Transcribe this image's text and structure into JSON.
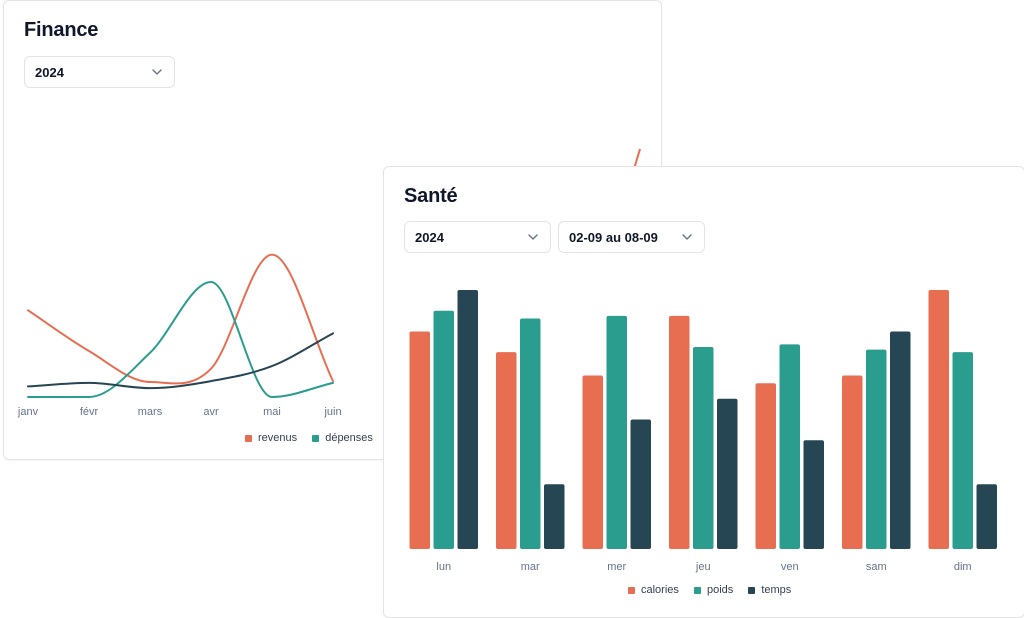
{
  "finance": {
    "title": "Finance",
    "year_select": {
      "value": "2024",
      "icon": "chevron-down-icon"
    },
    "legend": [
      {
        "label": "revenus",
        "color": "#e76e50"
      },
      {
        "label": "dépenses",
        "color": "#2a9d8f"
      }
    ]
  },
  "sante": {
    "title": "Santé",
    "year_select": {
      "value": "2024",
      "icon": "chevron-down-icon"
    },
    "range_select": {
      "value": "02-09 au 08-09",
      "icon": "chevron-down-icon"
    },
    "legend": [
      {
        "label": "calories",
        "color": "#e76e50"
      },
      {
        "label": "poids",
        "color": "#2a9d8f"
      },
      {
        "label": "temps",
        "color": "#264653"
      }
    ]
  },
  "chart_data": [
    {
      "type": "line",
      "categories": [
        "janv",
        "févr",
        "mars",
        "avr",
        "mai",
        "juin"
      ],
      "series": [
        {
          "name": "revenus",
          "color": "#e76e50",
          "values": [
            98,
            52,
            17,
            32,
            161,
            18
          ]
        },
        {
          "name": "dépenses",
          "color": "#2a9d8f",
          "values": [
            0,
            0,
            50,
            130,
            0,
            16
          ]
        },
        {
          "color": "#264653",
          "values": [
            12,
            16,
            10,
            18,
            35,
            72
          ]
        }
      ],
      "ylim": [
        0,
        190
      ],
      "grid": false,
      "legend_position": "bottom-right"
    },
    {
      "type": "bar",
      "categories": [
        "lun",
        "mar",
        "mer",
        "jeu",
        "ven",
        "sam",
        "dim"
      ],
      "series": [
        {
          "name": "calories",
          "color": "#e76e50",
          "values": [
            84,
            76,
            67,
            90,
            64,
            67,
            100
          ]
        },
        {
          "name": "poids",
          "color": "#2a9d8f",
          "values": [
            92,
            89,
            90,
            78,
            79,
            77,
            76
          ]
        },
        {
          "name": "temps",
          "color": "#264653",
          "values": [
            100,
            25,
            50,
            58,
            42,
            84,
            25
          ]
        }
      ],
      "ylim": [
        0,
        100
      ],
      "grid": false,
      "legend_position": "bottom-center"
    }
  ]
}
